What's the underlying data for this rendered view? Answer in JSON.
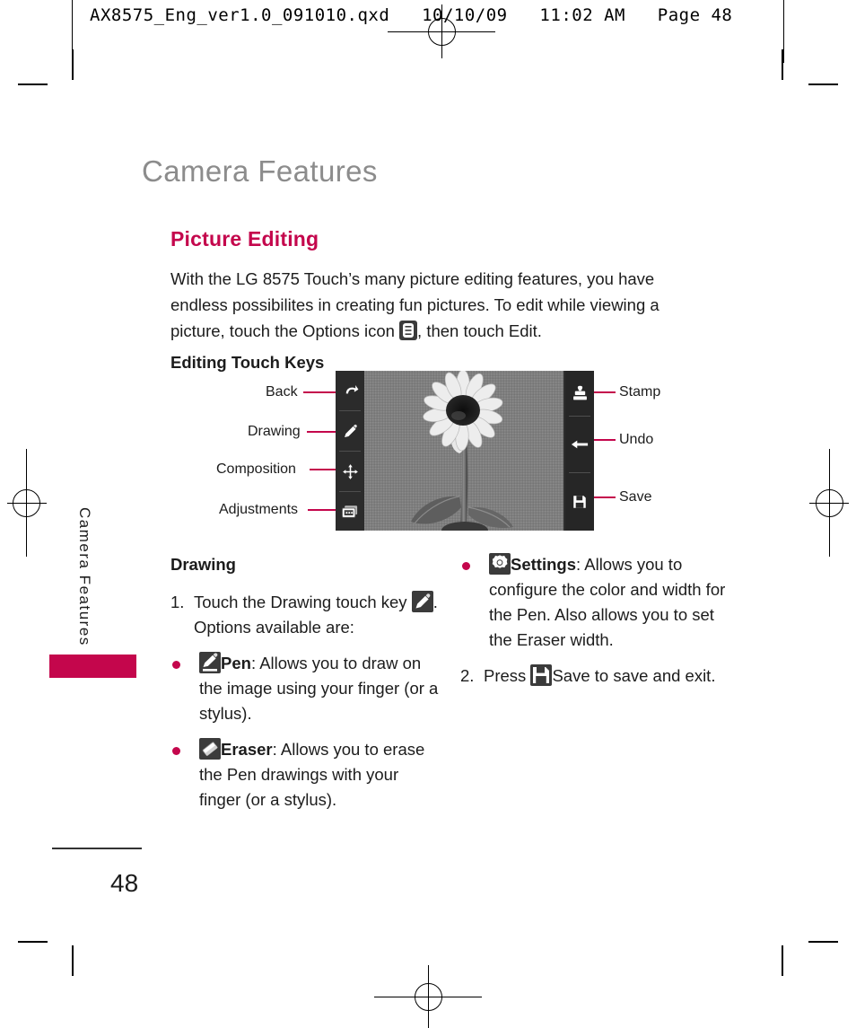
{
  "prepress": {
    "slug_text": "AX8575_Eng_ver1.0_091010.qxd   10/10/09   11:02 AM   Page 48"
  },
  "page": {
    "title": "Camera Features",
    "section_title": "Picture Editing",
    "page_number": "48",
    "side_tab_label": "Camera Features",
    "accent_color": "#c4064c",
    "title_color": "#8c8c8c"
  },
  "intro": {
    "part1": "With the LG 8575 Touch’s many picture editing features, you have endless possibilites in creating fun pictures. To edit while viewing a picture, touch the Options icon ",
    "part2": ", then touch Edit.",
    "options_icon": "options-icon"
  },
  "subhead": "Editing Touch Keys",
  "diagram": {
    "left_labels": [
      {
        "label": "Back",
        "icon": "back-arrow-icon"
      },
      {
        "label": "Drawing",
        "icon": "pencil-icon"
      },
      {
        "label": "Composition",
        "icon": "move-arrows-icon"
      },
      {
        "label": "Adjustments",
        "icon": "adjustments-icon"
      }
    ],
    "right_labels": [
      {
        "label": "Stamp",
        "icon": "stamp-icon"
      },
      {
        "label": "Undo",
        "icon": "undo-arrow-icon"
      },
      {
        "label": "Save",
        "icon": "floppy-save-icon"
      }
    ],
    "photo_description": "sunflower-photo"
  },
  "drawing_section": {
    "heading": "Drawing",
    "step1_before": "1. Touch the Drawing touch key",
    "step1_after": ". Options available are:",
    "step1_icon": "pencil-icon",
    "bullets": [
      {
        "icon": "pen-icon",
        "term": "Pen",
        "text": ": Allows you to draw on the image using your finger (or a stylus)."
      },
      {
        "icon": "eraser-icon",
        "term": "Eraser",
        "text": ": Allows you to erase the Pen drawings with your finger (or a stylus)."
      }
    ]
  },
  "settings_section": {
    "bullets": [
      {
        "icon": "settings-gear-icon",
        "term": "Settings",
        "text": ": Allows you to configure the color and width for the Pen. Also allows you to set the Eraser width."
      }
    ],
    "step2_before": "2. Press",
    "step2_after": "Save to save and exit.",
    "step2_icon": "floppy-save-icon"
  }
}
